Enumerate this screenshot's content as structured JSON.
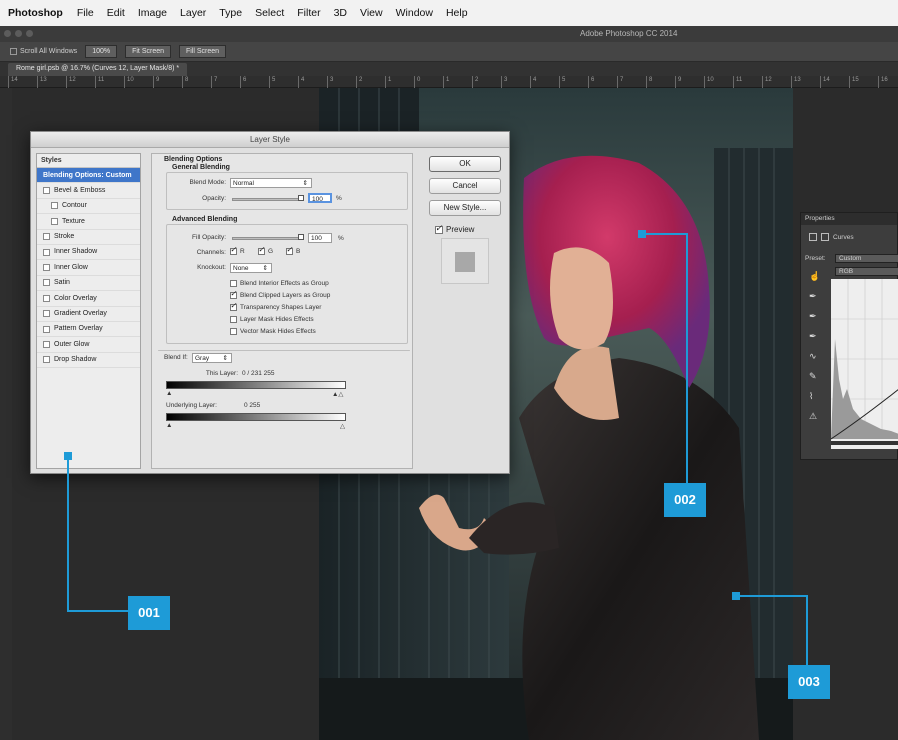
{
  "menubar": {
    "app_name": "Photoshop",
    "items": [
      "File",
      "Edit",
      "Image",
      "Layer",
      "Type",
      "Select",
      "Filter",
      "3D",
      "View",
      "Window",
      "Help"
    ]
  },
  "window": {
    "title": "Adobe Photoshop CC 2014"
  },
  "options_bar": {
    "scroll_all_label": "Scroll All Windows",
    "buttons": [
      "100%",
      "Fit Screen",
      "Fill Screen"
    ]
  },
  "document_tab": {
    "label": "Rome girl.psb @ 16.7% (Curves 12, Layer Mask/8) *"
  },
  "ruler": {
    "labels": [
      "14",
      "13",
      "12",
      "11",
      "10",
      "9",
      "8",
      "7",
      "6",
      "5",
      "4",
      "3",
      "2",
      "1",
      "0",
      "1",
      "2",
      "3",
      "4",
      "5",
      "6",
      "7",
      "8",
      "9",
      "10",
      "11",
      "12",
      "13",
      "14",
      "15",
      "16"
    ]
  },
  "dialog": {
    "title": "Layer Style",
    "styles_header": "Styles",
    "style_items": [
      {
        "label": "Blending Options: Custom",
        "selected": true,
        "checkbox": false,
        "indent": false
      },
      {
        "label": "Bevel & Emboss",
        "selected": false,
        "checkbox": true,
        "indent": false
      },
      {
        "label": "Contour",
        "selected": false,
        "checkbox": true,
        "indent": true
      },
      {
        "label": "Texture",
        "selected": false,
        "checkbox": true,
        "indent": true
      },
      {
        "label": "Stroke",
        "selected": false,
        "checkbox": true,
        "indent": false
      },
      {
        "label": "Inner Shadow",
        "selected": false,
        "checkbox": true,
        "indent": false
      },
      {
        "label": "Inner Glow",
        "selected": false,
        "checkbox": true,
        "indent": false
      },
      {
        "label": "Satin",
        "selected": false,
        "checkbox": true,
        "indent": false
      },
      {
        "label": "Color Overlay",
        "selected": false,
        "checkbox": true,
        "indent": false
      },
      {
        "label": "Gradient Overlay",
        "selected": false,
        "checkbox": true,
        "indent": false
      },
      {
        "label": "Pattern Overlay",
        "selected": false,
        "checkbox": true,
        "indent": false
      },
      {
        "label": "Outer Glow",
        "selected": false,
        "checkbox": true,
        "indent": false
      },
      {
        "label": "Drop Shadow",
        "selected": false,
        "checkbox": true,
        "indent": false
      }
    ],
    "blending_options_title": "Blending Options",
    "general_blending_title": "General Blending",
    "blend_mode_label": "Blend Mode:",
    "blend_mode_value": "Normal",
    "opacity_label": "Opacity:",
    "opacity_value": "100",
    "percent": "%",
    "advanced_blending_title": "Advanced Blending",
    "fill_opacity_label": "Fill Opacity:",
    "fill_opacity_value": "100",
    "channels_label": "Channels:",
    "channels": [
      "R",
      "G",
      "B"
    ],
    "knockout_label": "Knockout:",
    "knockout_value": "None",
    "checkbox_options": [
      {
        "label": "Blend Interior Effects as Group",
        "checked": false
      },
      {
        "label": "Blend Clipped Layers as Group",
        "checked": true
      },
      {
        "label": "Transparency Shapes Layer",
        "checked": true
      },
      {
        "label": "Layer Mask Hides Effects",
        "checked": false
      },
      {
        "label": "Vector Mask Hides Effects",
        "checked": false
      }
    ],
    "blend_if_label": "Blend If:",
    "blend_if_value": "Gray",
    "this_layer_label": "This Layer:",
    "this_layer_values": "0  /  231     255",
    "underlying_layer_label": "Underlying Layer:",
    "underlying_layer_values": "0                  255",
    "buttons": {
      "ok": "OK",
      "cancel": "Cancel",
      "new_style": "New Style..."
    },
    "preview_label": "Preview"
  },
  "properties": {
    "title": "Properties",
    "adjustment": "Curves",
    "preset_label": "Preset:",
    "preset_value": "Custom",
    "channel_value": "RGB"
  },
  "callouts": [
    "001",
    "002",
    "003"
  ],
  "colors": {
    "callout": "#1e9bd7",
    "selected_row": "#3f76c9"
  }
}
